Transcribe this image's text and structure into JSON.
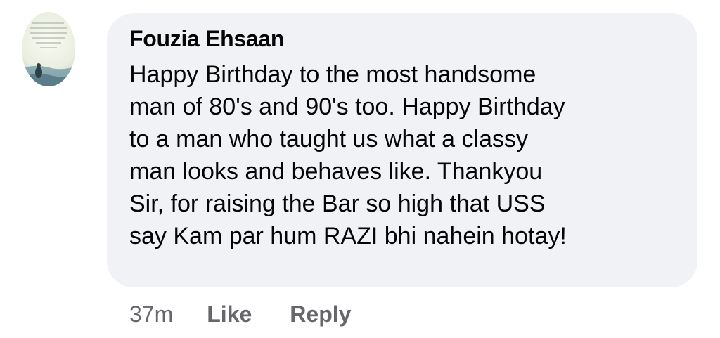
{
  "comment": {
    "author": "Fouzia Ehsaan",
    "text": "Happy Birthday to the most handsome\nman of 80's and 90's too. Happy Birthday\nto a man who taught us what a classy\nman looks and behaves like. Thankyou\nSir, for raising the Bar so high that USS\nsay Kam par hum RAZI bhi nahein hotay!",
    "timestamp": "37m",
    "like_label": "Like",
    "reply_label": "Reply"
  },
  "colors": {
    "bubble_background": "#f0f2f5",
    "text": "#050505",
    "secondary_text": "#65676b"
  },
  "avatar": {
    "icon": "profile-photo-quote-image"
  }
}
